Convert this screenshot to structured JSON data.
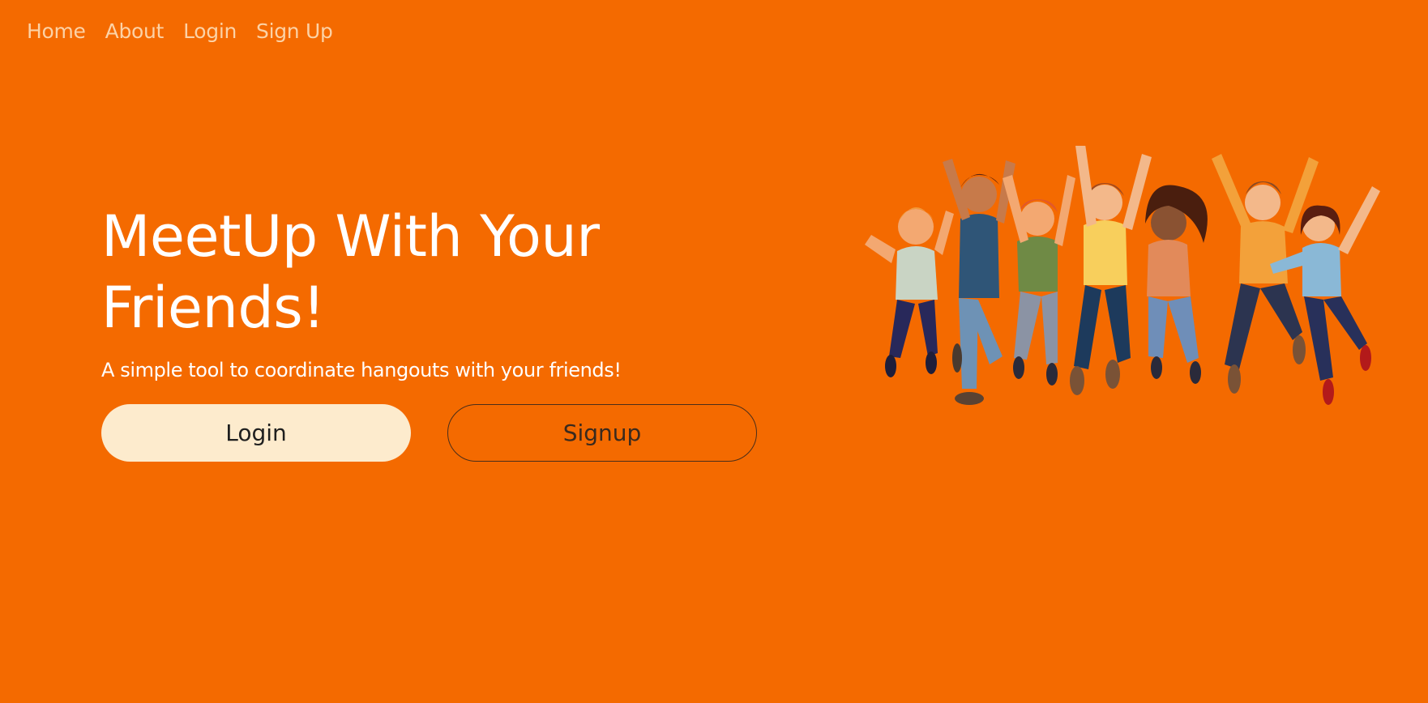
{
  "nav": {
    "items": [
      {
        "label": "Home"
      },
      {
        "label": "About"
      },
      {
        "label": "Login"
      },
      {
        "label": "Sign Up"
      }
    ]
  },
  "hero": {
    "headline_line1": "MeetUp With Your",
    "headline_line2": "Friends!",
    "subtitle": "A simple tool to coordinate hangouts with your friends!",
    "login_label": "Login",
    "signup_label": "Signup"
  },
  "colors": {
    "background": "#f46a00",
    "nav_link": "#fcd2a6",
    "login_button_bg": "#fdebcd",
    "text_primary": "#ffffff"
  },
  "illustration": {
    "icon": "jumping-friends-illustration"
  }
}
